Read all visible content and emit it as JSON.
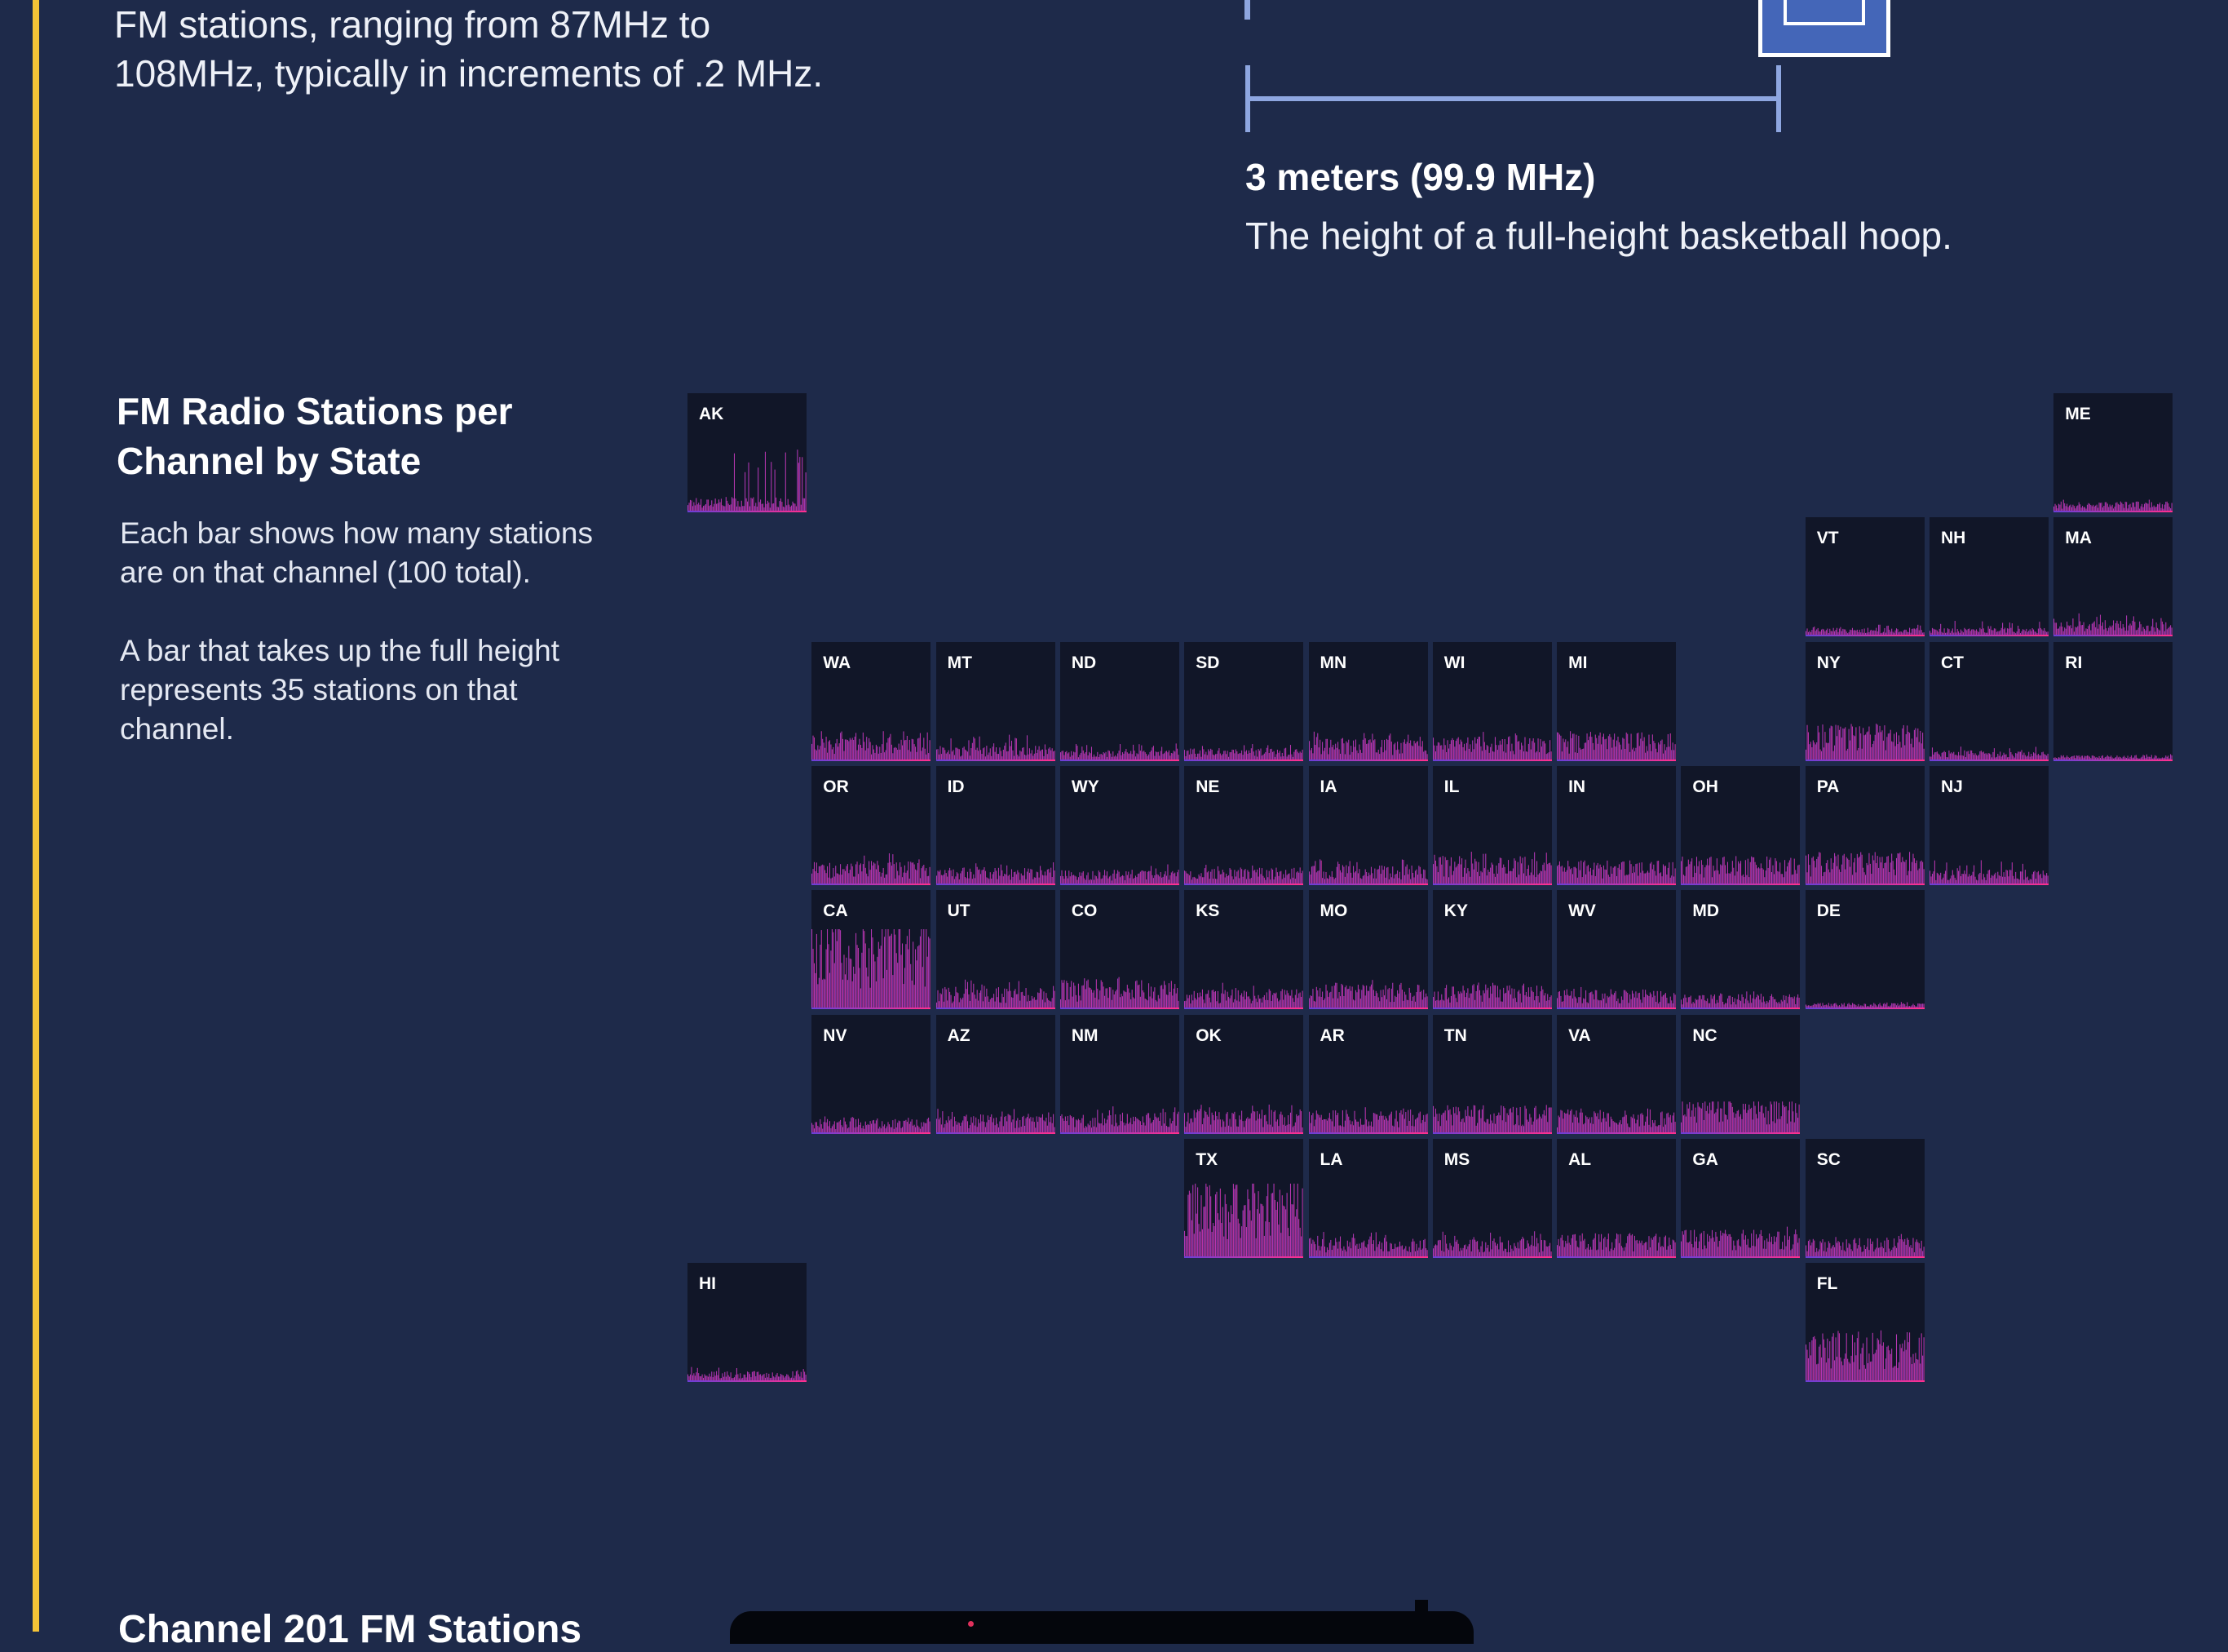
{
  "intro": {
    "line1": "FM stations, ranging from 87MHz to",
    "line2": "108MHz, typically in increments of .2 MHz."
  },
  "measure": {
    "label": "3 meters (99.9 MHz)",
    "desc": "The height of a full-height basketball hoop."
  },
  "section": {
    "title_line1": "FM Radio Stations per",
    "title_line2": "Channel by State",
    "desc1_line1": "Each bar shows how many stations",
    "desc1_line2": "are on that channel (100 total).",
    "desc2_line1": "A bar that takes up the full height",
    "desc2_line2": "represents 35 stations on that",
    "desc2_line3": "channel."
  },
  "colors": {
    "background": "#1e2a4a",
    "tile": "#111628",
    "accent": "#f5c437",
    "bar_start": "#6a3fd6",
    "bar_end": "#ff2f8e",
    "measure": "#8ea6e0"
  },
  "chart_data": {
    "type": "bar",
    "channels": 100,
    "full_height_stations": 35,
    "states": [
      {
        "id": "AK",
        "row": 0,
        "col": 0,
        "max": 22,
        "avg": 3
      },
      {
        "id": "ME",
        "row": 0,
        "col": 11,
        "max": 4,
        "avg": 2
      },
      {
        "id": "VT",
        "row": 1,
        "col": 9,
        "max": 4,
        "avg": 1.5
      },
      {
        "id": "NH",
        "row": 1,
        "col": 10,
        "max": 5,
        "avg": 1.5
      },
      {
        "id": "MA",
        "row": 1,
        "col": 11,
        "max": 8,
        "avg": 3
      },
      {
        "id": "WA",
        "row": 2,
        "col": 1,
        "max": 11,
        "avg": 5
      },
      {
        "id": "MT",
        "row": 2,
        "col": 2,
        "max": 9,
        "avg": 3
      },
      {
        "id": "ND",
        "row": 2,
        "col": 3,
        "max": 6,
        "avg": 2
      },
      {
        "id": "SD",
        "row": 2,
        "col": 4,
        "max": 6,
        "avg": 2.5
      },
      {
        "id": "MN",
        "row": 2,
        "col": 5,
        "max": 10,
        "avg": 4.5
      },
      {
        "id": "WI",
        "row": 2,
        "col": 6,
        "max": 10,
        "avg": 5
      },
      {
        "id": "MI",
        "row": 2,
        "col": 7,
        "max": 11,
        "avg": 6
      },
      {
        "id": "NY",
        "row": 2,
        "col": 9,
        "max": 13,
        "avg": 8
      },
      {
        "id": "CT",
        "row": 2,
        "col": 10,
        "max": 5,
        "avg": 2
      },
      {
        "id": "RI",
        "row": 2,
        "col": 11,
        "max": 2,
        "avg": 1
      },
      {
        "id": "OR",
        "row": 3,
        "col": 1,
        "max": 11,
        "avg": 5
      },
      {
        "id": "ID",
        "row": 3,
        "col": 2,
        "max": 8,
        "avg": 3.5
      },
      {
        "id": "WY",
        "row": 3,
        "col": 3,
        "max": 7,
        "avg": 3
      },
      {
        "id": "NE",
        "row": 3,
        "col": 4,
        "max": 7,
        "avg": 3.5
      },
      {
        "id": "IA",
        "row": 3,
        "col": 5,
        "max": 9,
        "avg": 4
      },
      {
        "id": "IL",
        "row": 3,
        "col": 6,
        "max": 12,
        "avg": 6
      },
      {
        "id": "IN",
        "row": 3,
        "col": 7,
        "max": 9,
        "avg": 5
      },
      {
        "id": "OH",
        "row": 3,
        "col": 8,
        "max": 10,
        "avg": 6
      },
      {
        "id": "PA",
        "row": 3,
        "col": 9,
        "max": 12,
        "avg": 7
      },
      {
        "id": "NJ",
        "row": 3,
        "col": 10,
        "max": 9,
        "avg": 3
      },
      {
        "id": "CA",
        "row": 4,
        "col": 1,
        "max": 28,
        "avg": 19
      },
      {
        "id": "UT",
        "row": 4,
        "col": 2,
        "max": 10,
        "avg": 4.5
      },
      {
        "id": "CO",
        "row": 4,
        "col": 3,
        "max": 11,
        "avg": 6
      },
      {
        "id": "KS",
        "row": 4,
        "col": 4,
        "max": 9,
        "avg": 4
      },
      {
        "id": "MO",
        "row": 4,
        "col": 5,
        "max": 10,
        "avg": 5
      },
      {
        "id": "KY",
        "row": 4,
        "col": 6,
        "max": 10,
        "avg": 5
      },
      {
        "id": "WV",
        "row": 4,
        "col": 7,
        "max": 8,
        "avg": 4
      },
      {
        "id": "MD",
        "row": 4,
        "col": 8,
        "max": 6,
        "avg": 3
      },
      {
        "id": "DE",
        "row": 4,
        "col": 9,
        "max": 2,
        "avg": 1
      },
      {
        "id": "NV",
        "row": 5,
        "col": 1,
        "max": 6,
        "avg": 3
      },
      {
        "id": "AZ",
        "row": 5,
        "col": 2,
        "max": 9,
        "avg": 4
      },
      {
        "id": "NM",
        "row": 5,
        "col": 3,
        "max": 10,
        "avg": 4.5
      },
      {
        "id": "OK",
        "row": 5,
        "col": 4,
        "max": 10,
        "avg": 5
      },
      {
        "id": "AR",
        "row": 5,
        "col": 5,
        "max": 9,
        "avg": 5
      },
      {
        "id": "TN",
        "row": 5,
        "col": 6,
        "max": 10,
        "avg": 6
      },
      {
        "id": "VA",
        "row": 5,
        "col": 7,
        "max": 9,
        "avg": 5
      },
      {
        "id": "NC",
        "row": 5,
        "col": 8,
        "max": 11,
        "avg": 8
      },
      {
        "id": "TX",
        "row": 6,
        "col": 4,
        "max": 26,
        "avg": 17
      },
      {
        "id": "LA",
        "row": 6,
        "col": 5,
        "max": 9,
        "avg": 4
      },
      {
        "id": "MS",
        "row": 6,
        "col": 6,
        "max": 9,
        "avg": 4
      },
      {
        "id": "AL",
        "row": 6,
        "col": 7,
        "max": 9,
        "avg": 5
      },
      {
        "id": "GA",
        "row": 6,
        "col": 8,
        "max": 11,
        "avg": 6
      },
      {
        "id": "SC",
        "row": 6,
        "col": 9,
        "max": 8,
        "avg": 4
      },
      {
        "id": "HI",
        "row": 7,
        "col": 0,
        "max": 5,
        "avg": 2
      },
      {
        "id": "FL",
        "row": 7,
        "col": 9,
        "max": 18,
        "avg": 11
      }
    ]
  },
  "bottom": {
    "title": "Channel 201 FM Stations"
  }
}
